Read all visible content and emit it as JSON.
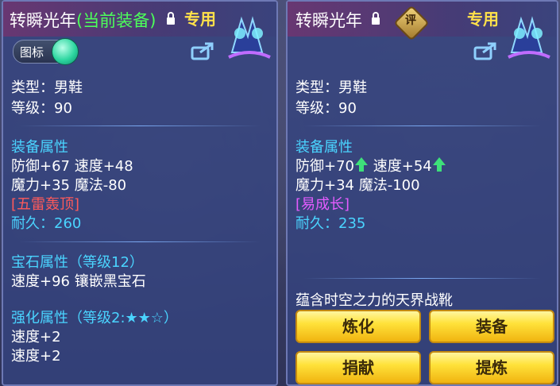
{
  "left_panel": {
    "item_name": "转瞬光年",
    "current_tag": "(当前装备)",
    "exclusive": "专用",
    "toggle_label": "图标",
    "type": "类型：男鞋",
    "level": "等级：90",
    "attr_title": "装备属性",
    "attr_line1": "防御+67 速度+48",
    "attr_line2": "魔力+35 魔法-80",
    "special": "[五雷轰顶]",
    "durability": "耐久：260",
    "gem_title": "宝石属性（等级12）",
    "gem_line": "速度+96 镶嵌黑宝石",
    "enhance_title": "强化属性（等级2:★★☆）",
    "enhance_line1": "速度+2",
    "enhance_line2": "速度+2"
  },
  "right_panel": {
    "item_name": "转瞬光年",
    "rate_badge": "评",
    "exclusive": "专用",
    "type": "类型：男鞋",
    "level": "等级：90",
    "attr_title": "装备属性",
    "def_text": "防御+70",
    "speed_text": "速度+54",
    "attr_line2": "魔力+34 魔法-100",
    "special": "[易成长]",
    "durability": "耐久：235",
    "description": "蕴含时空之力的天界战靴",
    "buttons": {
      "refine": "炼化",
      "equip": "装备",
      "donate": "捐献",
      "extract": "提炼"
    }
  },
  "colors": {
    "section": "#4ad4ff",
    "current_equip": "#4cff5a",
    "exclusive": "#ffe14a",
    "special_left": "#ff5a5a",
    "special_right": "#e45cff",
    "up_arrow": "#3ee07a"
  },
  "icons": [
    "lock-icon",
    "shoe-item-icon",
    "share-icon",
    "toggle-knob",
    "up-arrow-icon",
    "rate-badge-icon"
  ]
}
